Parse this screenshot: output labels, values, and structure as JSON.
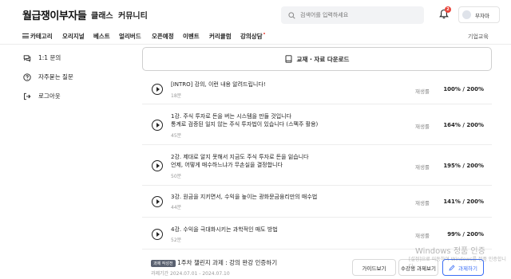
{
  "header": {
    "logo": "월급쟁이부자들",
    "nav": [
      "클래스",
      "커뮤니티"
    ],
    "search_placeholder": "검색어를 입력하세요",
    "notification_count": "2",
    "user_name": "부자마"
  },
  "category_nav": {
    "items": [
      "카테고리",
      "오리지널",
      "베스트",
      "얼리버드",
      "오픈예정",
      "이벤트",
      "커리큘럼",
      "강의상담"
    ],
    "corporate": "기업교육"
  },
  "sidebar": {
    "items": [
      {
        "label": "1:1 문의",
        "icon": "chat-bubble-icon"
      },
      {
        "label": "자주묻는 질문",
        "icon": "question-circle-icon"
      },
      {
        "label": "로그아웃",
        "icon": "logout-icon"
      }
    ]
  },
  "download": {
    "label": "교재 · 자료 다운로드"
  },
  "lessons": [
    {
      "title": "[INTRO] 강의, 이런 내용 알려드립니다!",
      "title2": "",
      "duration": "18분",
      "status": "재생률",
      "progress": "100% / 200%"
    },
    {
      "title": "1강. 주식 투자로 돈을 버는 시스템을 만들 것입니다",
      "title2": "통계로 검증된 일지 않는 주식 투자법이 있습니다 (스펙주 활용)",
      "duration": "45분",
      "status": "재생률",
      "progress": "164% / 200%"
    },
    {
      "title": "2강. 제대로 알지 못해서 지금도 주식 투자로 돈을 잃습니다",
      "title2": "언제, 어떻게 매수하느냐가 무손실을 결정합니다",
      "duration": "50분",
      "status": "재생률",
      "progress": "195% / 200%"
    },
    {
      "title": "3강. 원금을 지키면서, 수익을 높이는 광화문금융리만의 매수법",
      "title2": "",
      "duration": "44분",
      "status": "재생률",
      "progress": "141% / 200%"
    },
    {
      "title": "4강. 수익을 극대화시키는 과학적인 매도 방법",
      "title2": "",
      "duration": "52분",
      "status": "재생률",
      "progress": "99% / 200%"
    }
  ],
  "assignment": {
    "badge": "과제 작성전",
    "title": "1주차 챌린지 과제 : 강의 완강 인증하기",
    "period": "과제기간 2024.07.01 - 2024.07.10",
    "buttons": {
      "guide": "가이드보기",
      "student": "수강생 과제보기",
      "write": "과제하기"
    }
  },
  "watermark": {
    "title": "Windows 정품 인증",
    "subtitle": "[설정]으로 이동하여 Windows를 정품 인증합니다."
  }
}
